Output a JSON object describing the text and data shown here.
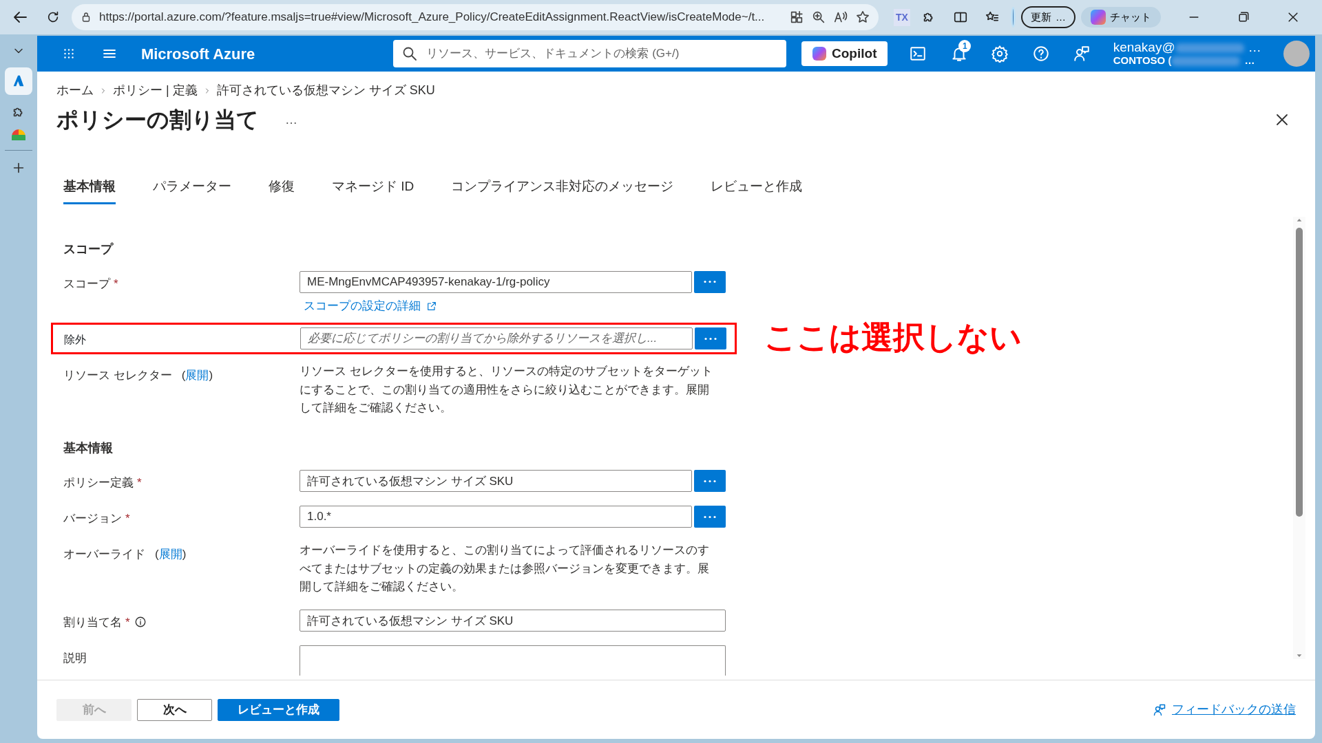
{
  "browser": {
    "url": "https://portal.azure.com/?feature.msaljs=true#view/Microsoft_Azure_Policy/CreateEditAssignment.ReactView/isCreateMode~/t...",
    "extension_label": "TX",
    "update_button": "更新",
    "update_more": "…",
    "chat_button": "チャット"
  },
  "portal": {
    "brand": "Microsoft Azure",
    "search_placeholder": "リソース、サービス、ドキュメントの検索 (G+/)",
    "copilot": "Copilot",
    "notification_count": "1",
    "account_user": "kenakay@",
    "account_tenant": "CONTOSO (",
    "account_more": "…"
  },
  "breadcrumb": [
    "ホーム",
    "ポリシー | 定義",
    "許可されている仮想マシン サイズ SKU"
  ],
  "title": "ポリシーの割り当て",
  "title_more": "…",
  "tabs": [
    {
      "label": "基本情報",
      "selected": true
    },
    {
      "label": "パラメーター",
      "selected": false
    },
    {
      "label": "修復",
      "selected": false
    },
    {
      "label": "マネージド ID",
      "selected": false
    },
    {
      "label": "コンプライアンス非対応のメッセージ",
      "selected": false
    },
    {
      "label": "レビューと作成",
      "selected": false
    }
  ],
  "rows": [
    {
      "kind": "heading",
      "text": "スコープ"
    },
    {
      "kind": "field",
      "label": "スコープ",
      "required_mark": "*",
      "value": "ME-MngEnvMCAP493957-kenakay-1/rg-policy",
      "browse": true,
      "link": "スコープの設定の詳細"
    },
    {
      "kind": "field",
      "label": "除外",
      "placeholder": "必要に応じてポリシーの割り当てから除外するリソースを選択し...",
      "browse": true,
      "highlighted": true,
      "annotation": "ここは選択しない"
    },
    {
      "kind": "info",
      "label": "リソース セレクター",
      "open_paren": "(",
      "expand": "展開",
      "close_paren": ")",
      "text": "リソース セレクターを使用すると、リソースの特定のサブセットをターゲットにすることで、この割り当ての適用性をさらに絞り込むことができます。展開して詳細をご確認ください。"
    },
    {
      "kind": "heading",
      "text": "基本情報"
    },
    {
      "kind": "field",
      "label": "ポリシー定義",
      "required_mark": "*",
      "value": "許可されている仮想マシン サイズ SKU",
      "browse": true
    },
    {
      "kind": "field",
      "label": "バージョン",
      "required_mark": "*",
      "value": "1.0.*",
      "browse": true
    },
    {
      "kind": "info",
      "label": "オーバーライド",
      "open_paren": "(",
      "expand": "展開",
      "close_paren": ")",
      "text": "オーバーライドを使用すると、この割り当てによって評価されるリソースのすべてまたはサブセットの定義の効果または参照バージョンを変更できます。展開して詳細をご確認ください。"
    },
    {
      "kind": "field",
      "label": "割り当て名",
      "required_mark": "*",
      "info_icon": true,
      "value": "許可されている仮想マシン サイズ SKU"
    },
    {
      "kind": "textarea",
      "label": "説明"
    }
  ],
  "footer": {
    "buttons": [
      {
        "label": "前へ",
        "kind": "default",
        "disabled": true
      },
      {
        "label": "次へ",
        "kind": "default",
        "disabled": false
      },
      {
        "label": "レビューと作成",
        "kind": "primary",
        "disabled": false
      }
    ],
    "feedback": "フィードバックの送信"
  }
}
